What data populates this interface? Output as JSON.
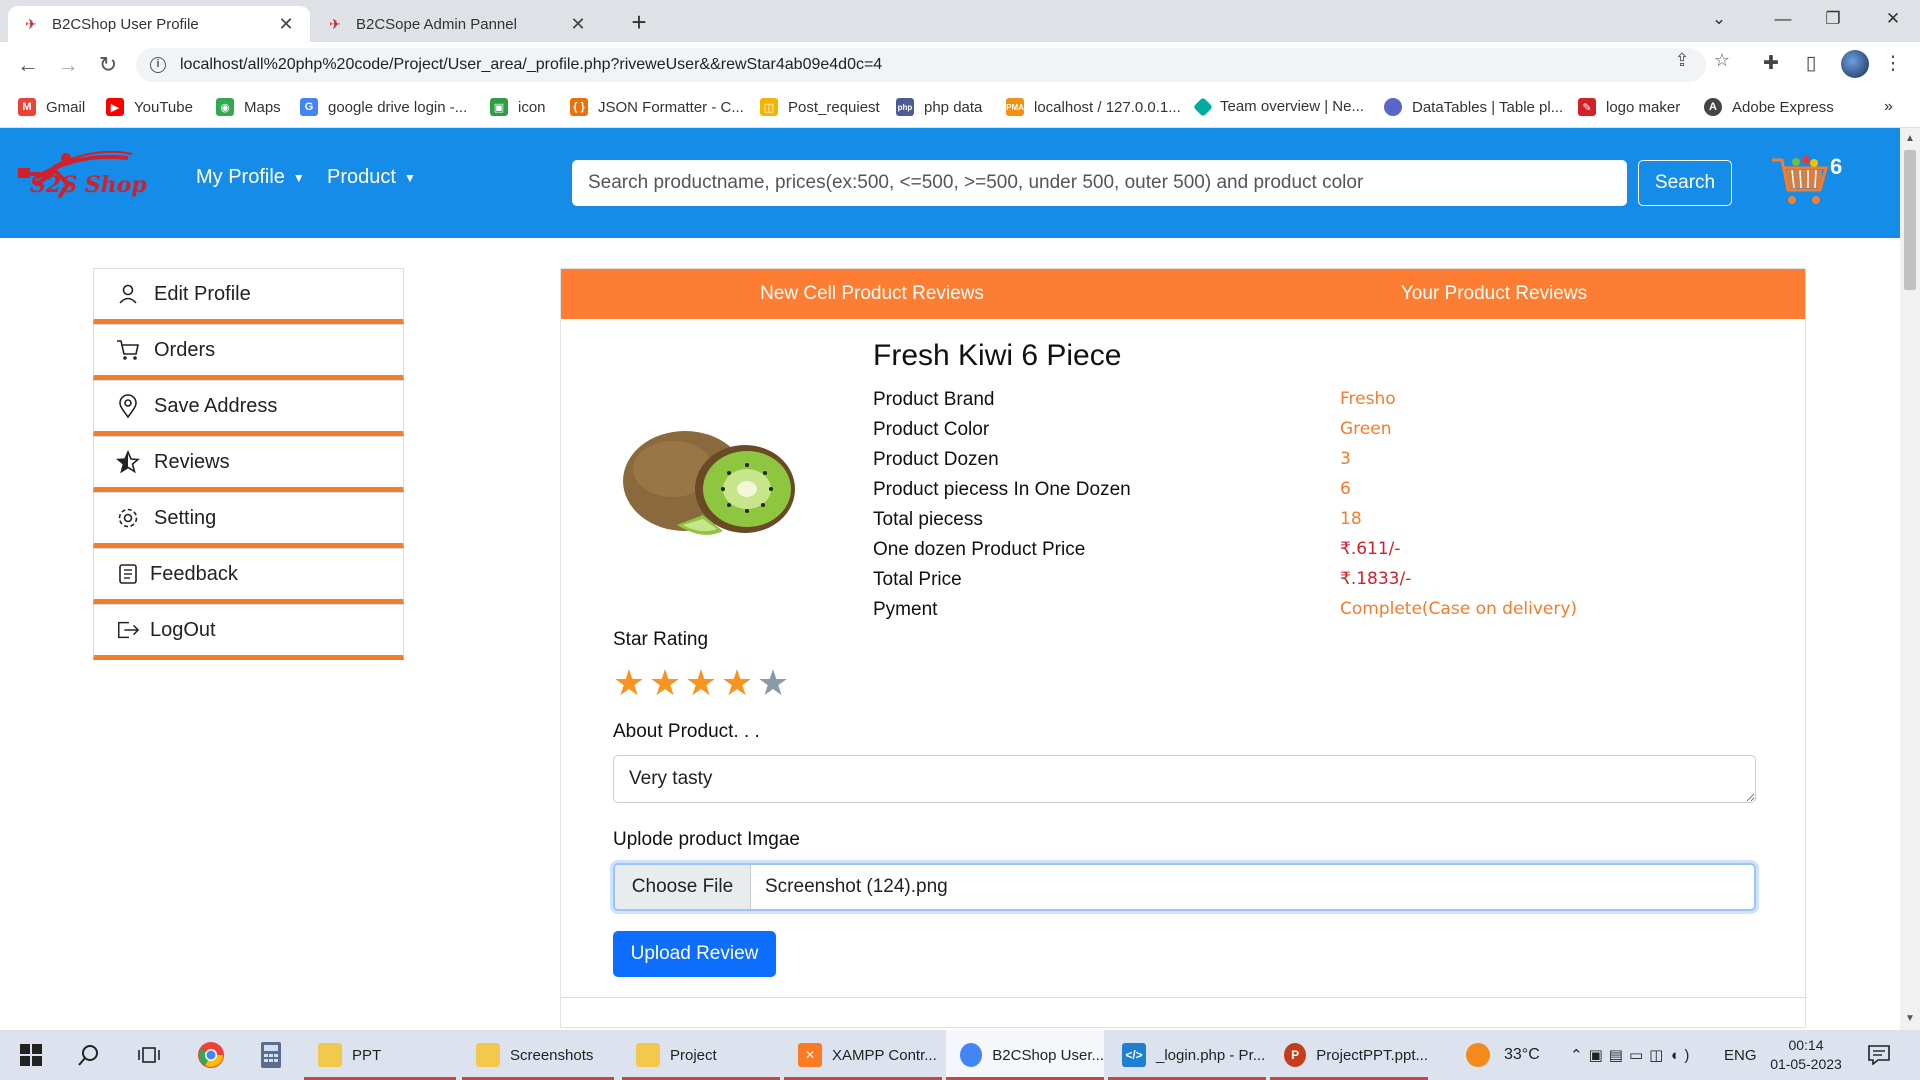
{
  "browser": {
    "tabs": [
      {
        "title": "B2CShop User Profile",
        "active": true
      },
      {
        "title": "B2CSope Admin Pannel",
        "active": false
      }
    ],
    "url": "localhost/all%20php%20code/Project/User_area/_profile.php?riveweUser&&rewStar4ab09e4d0c=4",
    "bookmarks": [
      {
        "label": "Gmail",
        "icon": "gmail-icon",
        "color": "#ea4335"
      },
      {
        "label": "YouTube",
        "icon": "youtube-icon",
        "color": "#ff0000"
      },
      {
        "label": "Maps",
        "icon": "maps-icon",
        "color": "#34a853"
      },
      {
        "label": "google drive login -...",
        "icon": "google-icon",
        "color": "#4285f4"
      },
      {
        "label": "icon",
        "icon": "icon-site-icon",
        "color": "#2e9e44"
      },
      {
        "label": "JSON Formatter - C...",
        "icon": "json-icon",
        "color": "#e8710a"
      },
      {
        "label": "Post_requiest",
        "icon": "post-icon",
        "color": "#f4b400"
      },
      {
        "label": "php data",
        "icon": "php-icon",
        "color": "#4f5b93"
      },
      {
        "label": "localhost / 127.0.0.1...",
        "icon": "phpmyadmin-icon",
        "color": "#f29111"
      },
      {
        "label": "Team overview | Ne...",
        "icon": "team-icon",
        "color": "#00ad9f"
      },
      {
        "label": "DataTables | Table pl...",
        "icon": "datatables-icon",
        "color": "#5865c9"
      },
      {
        "label": "logo maker",
        "icon": "logo-maker-icon",
        "color": "#d0202a"
      },
      {
        "label": "Adobe Express",
        "icon": "adobe-icon",
        "color": "#444444"
      }
    ]
  },
  "header": {
    "logo_text": "S2S Shop",
    "menu": [
      {
        "label": "My Profile"
      },
      {
        "label": "Product"
      }
    ],
    "search_placeholder": "Search productname, prices(ex:500, <=500, >=500, under 500, outer 500) and product color",
    "search_button": "Search",
    "cart_count": "6",
    "colors": {
      "header_bg": "#158ce8",
      "accent": "#fd7e32"
    }
  },
  "sidebar": {
    "items": [
      {
        "label": "Edit Profile",
        "icon": "user-icon"
      },
      {
        "label": "Orders",
        "icon": "cart-icon"
      },
      {
        "label": "Save Address",
        "icon": "location-icon"
      },
      {
        "label": "Reviews",
        "icon": "star-icon"
      },
      {
        "label": "Setting",
        "icon": "gear-icon"
      },
      {
        "label": "Feedback",
        "icon": "feedback-icon"
      },
      {
        "label": "LogOut",
        "icon": "logout-icon"
      }
    ]
  },
  "review_card": {
    "tabs": [
      "New Cell Product Reviews",
      "Your Product Reviews"
    ],
    "product_title": "Fresh Kiwi 6 Piece",
    "specs": [
      {
        "label": "Product Brand",
        "value": "Fresho"
      },
      {
        "label": "Product Color",
        "value": "Green"
      },
      {
        "label": "Product Dozen",
        "value": "3"
      },
      {
        "label": "Product piecess In One Dozen",
        "value": "6"
      },
      {
        "label": "Total piecess",
        "value": "18"
      },
      {
        "label": "One dozen Product Price",
        "value": "₹.611/-"
      },
      {
        "label": "Total Price",
        "value": "₹.1833/-"
      },
      {
        "label": "Pyment",
        "value": "Complete(Case on delivery)"
      }
    ],
    "star_rating_label": "Star Rating",
    "star_rating": 4,
    "star_max": 5,
    "about_label": "About Product. . .",
    "about_value": "Very tasty",
    "upload_label": "Uplode product Imgae",
    "choose_file_label": "Choose File",
    "file_name": "Screenshot (124).png",
    "submit_label": "Upload Review"
  },
  "taskbar": {
    "apps": [
      {
        "label": "PPT",
        "icon": "folder-icon"
      },
      {
        "label": "Screenshots",
        "icon": "folder-icon"
      },
      {
        "label": "Project",
        "icon": "folder-icon"
      },
      {
        "label": "XAMPP Contr...",
        "icon": "xampp-icon"
      },
      {
        "label": "B2CShop User...",
        "icon": "chrome-icon"
      },
      {
        "label": "_login.php - Pr...",
        "icon": "vscode-icon"
      },
      {
        "label": "ProjectPPT.ppt...",
        "icon": "powerpoint-icon"
      }
    ],
    "weather": "33°C",
    "language": "ENG",
    "time": "00:14",
    "date": "01-05-2023"
  }
}
